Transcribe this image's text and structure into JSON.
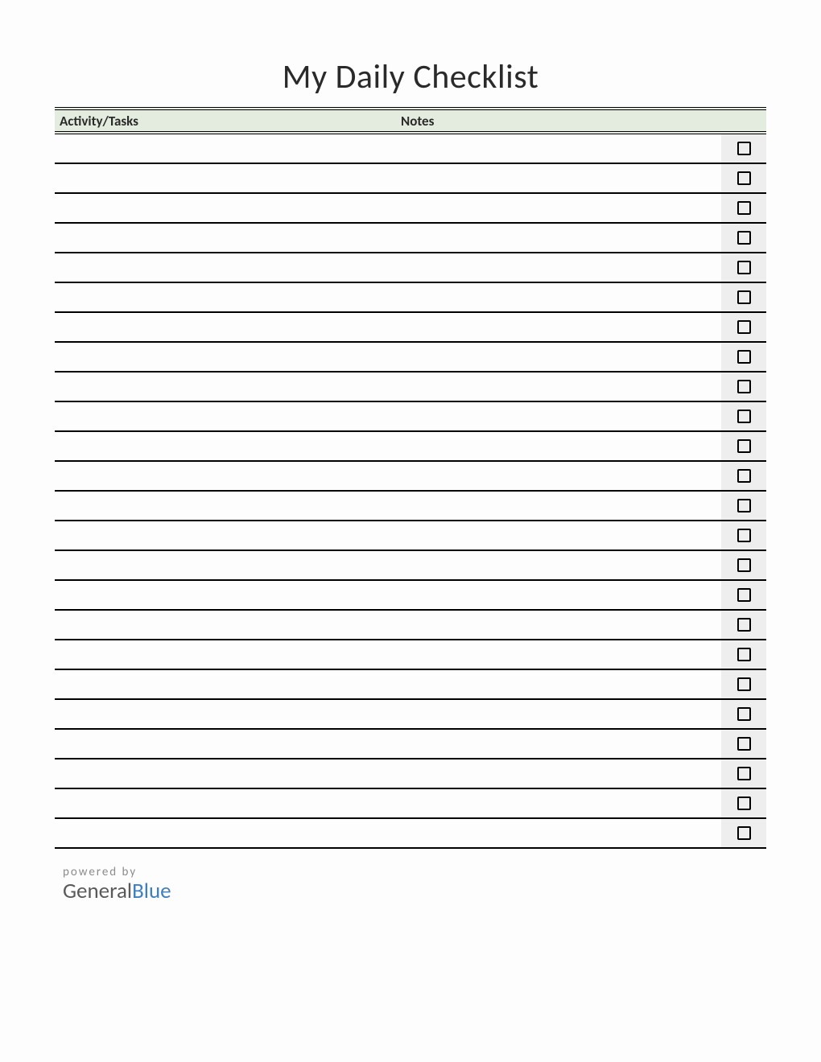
{
  "title": "My Daily Checklist",
  "headers": {
    "activity": "Activity/Tasks",
    "notes": "Notes"
  },
  "rows": [
    {
      "activity": "",
      "notes": "",
      "checked": false
    },
    {
      "activity": "",
      "notes": "",
      "checked": false
    },
    {
      "activity": "",
      "notes": "",
      "checked": false
    },
    {
      "activity": "",
      "notes": "",
      "checked": false
    },
    {
      "activity": "",
      "notes": "",
      "checked": false
    },
    {
      "activity": "",
      "notes": "",
      "checked": false
    },
    {
      "activity": "",
      "notes": "",
      "checked": false
    },
    {
      "activity": "",
      "notes": "",
      "checked": false
    },
    {
      "activity": "",
      "notes": "",
      "checked": false
    },
    {
      "activity": "",
      "notes": "",
      "checked": false
    },
    {
      "activity": "",
      "notes": "",
      "checked": false
    },
    {
      "activity": "",
      "notes": "",
      "checked": false
    },
    {
      "activity": "",
      "notes": "",
      "checked": false
    },
    {
      "activity": "",
      "notes": "",
      "checked": false
    },
    {
      "activity": "",
      "notes": "",
      "checked": false
    },
    {
      "activity": "",
      "notes": "",
      "checked": false
    },
    {
      "activity": "",
      "notes": "",
      "checked": false
    },
    {
      "activity": "",
      "notes": "",
      "checked": false
    },
    {
      "activity": "",
      "notes": "",
      "checked": false
    },
    {
      "activity": "",
      "notes": "",
      "checked": false
    },
    {
      "activity": "",
      "notes": "",
      "checked": false
    },
    {
      "activity": "",
      "notes": "",
      "checked": false
    },
    {
      "activity": "",
      "notes": "",
      "checked": false
    },
    {
      "activity": "",
      "notes": "",
      "checked": false
    }
  ],
  "footer": {
    "powered": "powered by",
    "brand_a": "General",
    "brand_b": "Blue"
  }
}
